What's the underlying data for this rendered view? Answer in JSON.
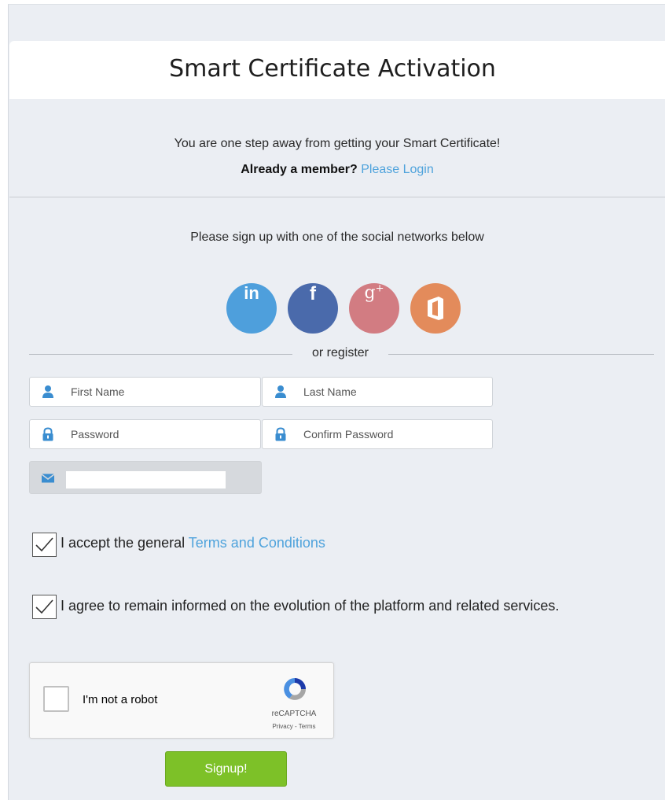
{
  "header": {
    "title": "Smart Certificate Activation"
  },
  "intro": {
    "message": "You are one step away from getting your Smart Certificate!",
    "member_question": "Already a member?",
    "login_link": "Please Login"
  },
  "social": {
    "prompt": "Please sign up with one of the social networks below",
    "buttons": [
      {
        "icon": "linkedin-icon",
        "glyph": "in",
        "color": "#4e9fdc"
      },
      {
        "icon": "facebook-icon",
        "glyph": "f",
        "color": "#4a6aab"
      },
      {
        "icon": "google-plus-icon",
        "glyph": "g+",
        "color": "#d27c82"
      },
      {
        "icon": "office-icon",
        "color": "#e38b5b"
      }
    ]
  },
  "form": {
    "separator": "or register",
    "first_name": {
      "placeholder": "First Name",
      "value": ""
    },
    "last_name": {
      "placeholder": "Last Name",
      "value": ""
    },
    "password": {
      "placeholder": "Password",
      "value": ""
    },
    "confirm_password": {
      "placeholder": "Confirm Password",
      "value": ""
    },
    "email": {
      "icon": "envelope-icon",
      "value": ""
    },
    "terms": {
      "checked": true,
      "prefix": "I accept the general",
      "link": "Terms and Conditions"
    },
    "informed": {
      "checked": true,
      "label": "I agree to remain informed on the evolution of the platform and related services."
    },
    "captcha": {
      "label": "I'm not a robot",
      "brand": "reCAPTCHA",
      "links": "Privacy - Terms"
    },
    "submit_label": "Signup!"
  },
  "colors": {
    "link": "#4fa3dc",
    "submit": "#7dc128",
    "panel": "#ebeef3"
  }
}
